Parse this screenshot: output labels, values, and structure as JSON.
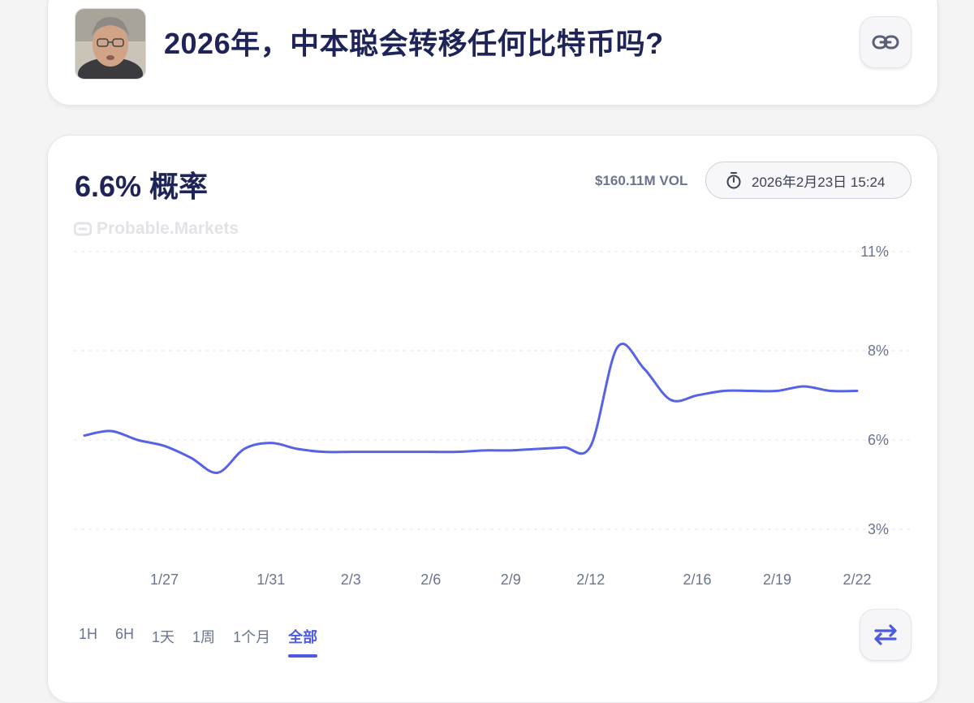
{
  "header": {
    "title": "2026年，中本聪会转移任何比特币吗?"
  },
  "stats": {
    "probability": "6.6% 概率",
    "volume": "$160.11M VOL",
    "end_date": "2026年2月23日 15:24"
  },
  "watermark": "Probable.Markets",
  "timeframes": [
    "1H",
    "6H",
    "1天",
    "1周",
    "1个月",
    "全部"
  ],
  "active_timeframe": "全部",
  "icons": {
    "link": "link-icon",
    "timer": "stopwatch-icon",
    "swap": "swap-arrows-icon"
  },
  "colors": {
    "line": "#5663e6",
    "title": "#1f2458",
    "accent": "#4b5ae0"
  },
  "chart_data": {
    "type": "line",
    "x": [
      "1/24",
      "1/25",
      "1/26",
      "1/27",
      "1/28",
      "1/29",
      "1/30",
      "1/31",
      "2/1",
      "2/2",
      "2/3",
      "2/4",
      "2/5",
      "2/6",
      "2/7",
      "2/8",
      "2/9",
      "2/10",
      "2/11",
      "2/12",
      "2/13",
      "2/14",
      "2/15",
      "2/16",
      "2/17",
      "2/18",
      "2/19",
      "2/20",
      "2/21",
      "2/22"
    ],
    "series": [
      {
        "values": [
          6.1,
          6.2,
          6.0,
          5.8,
          5.4,
          4.9,
          5.7,
          5.9,
          5.7,
          5.6,
          5.6,
          5.6,
          5.6,
          5.6,
          5.6,
          5.65,
          5.65,
          5.7,
          5.75,
          5.8,
          8.1,
          7.6,
          6.9,
          7.0,
          7.1,
          7.1,
          7.1,
          7.2,
          7.1,
          7.1
        ]
      }
    ],
    "x_tick_labels": [
      "1/27",
      "1/31",
      "2/3",
      "2/6",
      "2/9",
      "2/12",
      "2/16",
      "2/19",
      "2/22"
    ],
    "y_tick_labels": [
      "11%",
      "8%",
      "6%",
      "3%"
    ],
    "ylim": [
      3,
      11
    ],
    "grid": true,
    "y_axis_position": "right"
  }
}
